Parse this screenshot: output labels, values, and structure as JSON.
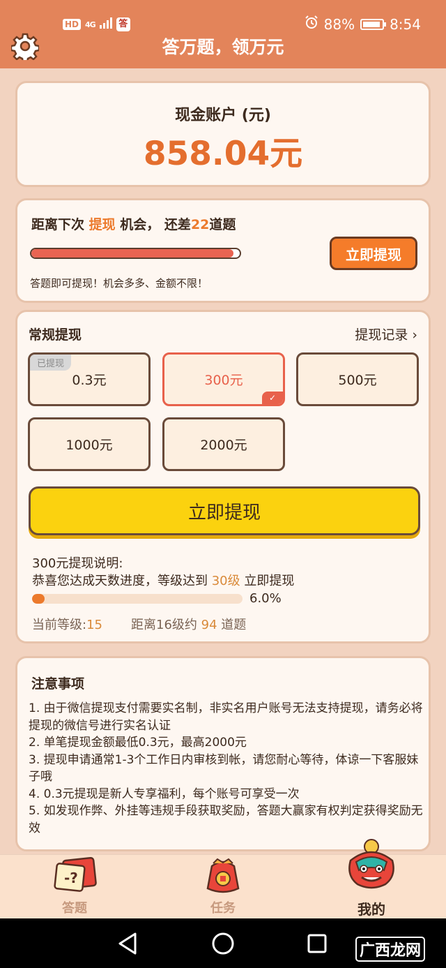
{
  "status_bar": {
    "network": "HD",
    "signal": "4G",
    "app_badge": "答",
    "battery": "88%",
    "time": "8:54"
  },
  "header": {
    "title": "答万题，领万元",
    "settings_icon": "gear-icon"
  },
  "account": {
    "title": "现金账户 (元)",
    "amount": "858.04元"
  },
  "next_withdraw": {
    "prefix": "距离下次",
    "keyword": "提现",
    "middle": "机会，",
    "remain_prefix": "还差",
    "remain_count": "22",
    "remain_suffix": "道题",
    "progress": 0.97,
    "button_label": "立即提现",
    "note": "答题即可提现！机会多多、金额不限！"
  },
  "regular_withdraw": {
    "title": "常规提现",
    "records_link": "提现记录",
    "options": [
      {
        "label": "0.3元",
        "tag": "已提现",
        "selected": false
      },
      {
        "label": "300元",
        "tag": "",
        "selected": true
      },
      {
        "label": "500元",
        "tag": "",
        "selected": false
      },
      {
        "label": "1000元",
        "tag": "",
        "selected": false
      },
      {
        "label": "2000元",
        "tag": "",
        "selected": false
      }
    ],
    "submit_label": "立即提现",
    "desc_title": "300元提现说明:",
    "desc_prefix": "恭喜您达成天数进度，等级达到",
    "desc_level": "30级",
    "desc_suffix": "立即提现",
    "level_progress": 0.06,
    "level_progress_label": "6.0%",
    "current_level_label": "当前等级:",
    "current_level": "15",
    "next_level_prefix": "距离16级约",
    "next_level_count": "94",
    "next_level_suffix": "道题"
  },
  "notes": {
    "title": "注意事项",
    "items": [
      "1. 由于微信提现支付需要实名制，非实名用户账号无法支持提现，请务必将提现的微信号进行实名认证",
      "2. 单笔提现金额最低0.3元，最高2000元",
      "3. 提现申请通常1-3个工作日内审核到帐，请您耐心等待，体谅一下客服妹子哦",
      "4. 0.3元提现是新人专享福利，每个账号可享受一次",
      "5. 如发现作弊、外挂等违规手段获取奖励，答题大赢家有权判定获得奖励无效"
    ]
  },
  "bottom_nav": {
    "items": [
      {
        "label": "答题",
        "icon": "quiz-card-icon",
        "active": false
      },
      {
        "label": "任务",
        "icon": "red-envelope-icon",
        "active": false
      },
      {
        "label": "我的",
        "icon": "lion-mascot-icon",
        "active": true
      }
    ]
  },
  "watermark": "广西龙网",
  "colors": {
    "header_bg": "#e3845a",
    "accent": "#ec7a2c",
    "button_yellow": "#fbd20f",
    "progress_red": "#e96452"
  }
}
